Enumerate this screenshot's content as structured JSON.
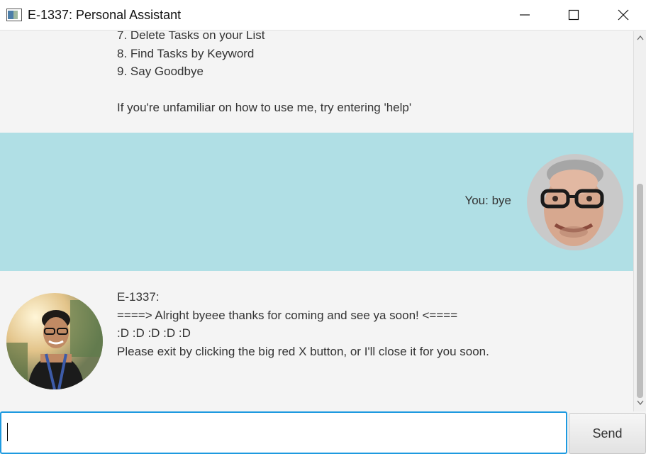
{
  "window": {
    "title": "E-1337: Personal Assistant",
    "icon": "app-window-icon",
    "controls": [
      "minimize-icon",
      "maximize-icon",
      "close-icon"
    ]
  },
  "chat": {
    "bot_help_lines": "7. Delete Tasks on your List\n8. Find Tasks by Keyword\n9. Say Goodbye\n\nIf you're unfamiliar on how to use me, try entering 'help'",
    "user_message": "You: bye",
    "bot_reply": "E-1337:\n====> Alright byeee thanks for coming and see ya soon! <====\n:D :D :D :D :D\nPlease exit by clicking the big red X button, or I'll close it for you soon.",
    "user_row_color": "#b0dfe5",
    "user_avatar": "user-avatar",
    "bot_avatar": "bot-avatar"
  },
  "input": {
    "value": "",
    "placeholder": "",
    "focus_color": "#1e9ae0"
  },
  "send_button": {
    "label": "Send"
  }
}
